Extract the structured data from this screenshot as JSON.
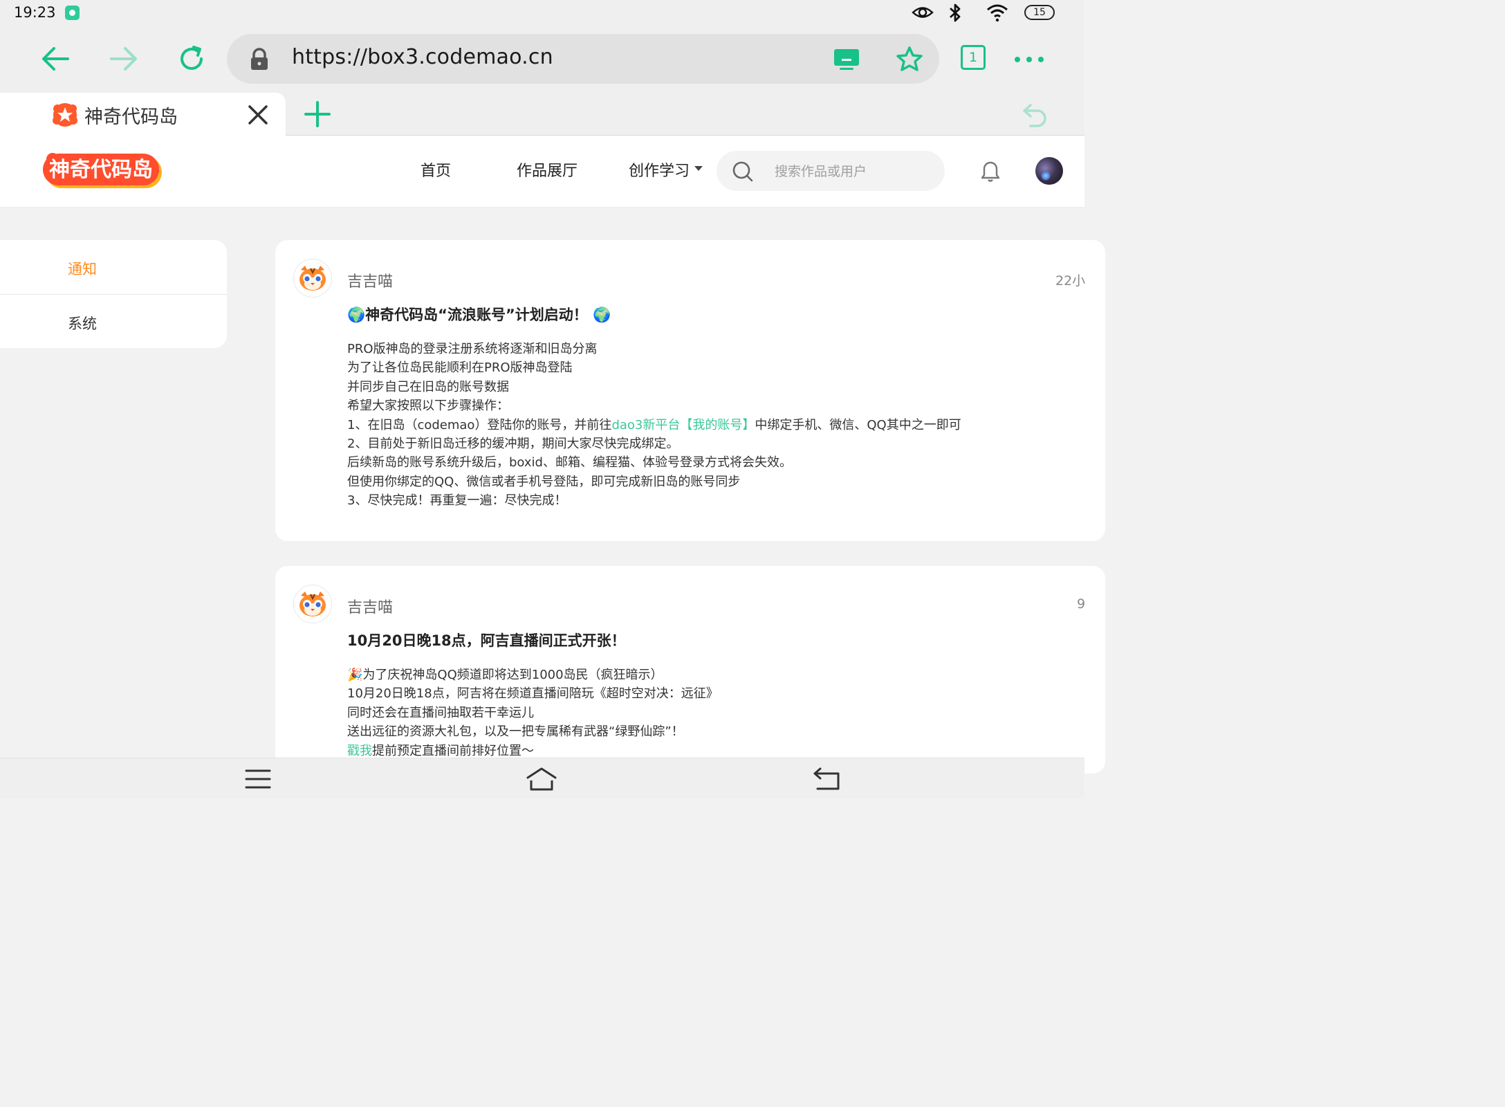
{
  "status_bar": {
    "time": "19:23",
    "battery": "15",
    "icons": [
      "eye-icon",
      "bluetooth-icon",
      "wifi-icon",
      "battery-icon"
    ]
  },
  "browser": {
    "url": "https://box3.codemao.cn",
    "tab_count": "1",
    "tabs": [
      {
        "title": "神奇代码岛"
      }
    ],
    "accent_color": "#17c188"
  },
  "site": {
    "logo_text": "神奇代码岛",
    "nav": {
      "home": "首页",
      "gallery": "作品展厅",
      "learn": "创作学习"
    },
    "search_placeholder": "搜索作品或用户"
  },
  "sidebar": {
    "items": [
      {
        "label": "通知",
        "active": true
      },
      {
        "label": "系统",
        "active": false
      }
    ],
    "active_color": "#ff8a1c"
  },
  "notifications": [
    {
      "user": "吉吉喵",
      "time": "22小",
      "title": "🌍神奇代码岛“流浪账号”计划启动！ 🌍",
      "lines": [
        "PRO版神岛的登录注册系统将逐渐和旧岛分离",
        "为了让各位岛民能顺利在PRO版神岛登陆",
        "并同步自己在旧岛的账号数据",
        "希望大家按照以下步骤操作："
      ],
      "line5_before": "1、在旧岛（codemao）登陆你的账号，并前往",
      "line5_link": "dao3新平台【我的账号】",
      "line5_after": "中绑定手机、微信、QQ其中之一即可",
      "lines_after": [
        "2、目前处于新旧岛迁移的缓冲期，期间大家尽快完成绑定。",
        "后续新岛的账号系统升级后，boxid、邮箱、编程猫、体验号登录方式将会失效。",
        "但使用你绑定的QQ、微信或者手机号登陆，即可完成新旧岛的账号同步",
        "3、尽快完成！再重复一遍：尽快完成！"
      ]
    },
    {
      "user": "吉吉喵",
      "time": "9",
      "title": "10月20日晚18点，阿吉直播间正式开张！",
      "lines": [
        "🎉为了庆祝神岛QQ频道即将达到1000岛民（疯狂暗示）",
        "10月20日晚18点，阿吉将在频道直播间陪玩《超时空对决：远征》",
        "同时还会在直播间抽取若干幸运儿",
        "送出远征的资源大礼包，以及一把专属稀有武器“绿野仙踪”！"
      ],
      "last_link": "戳我",
      "last_after": "提前预定直播间前排好位置～"
    }
  ]
}
